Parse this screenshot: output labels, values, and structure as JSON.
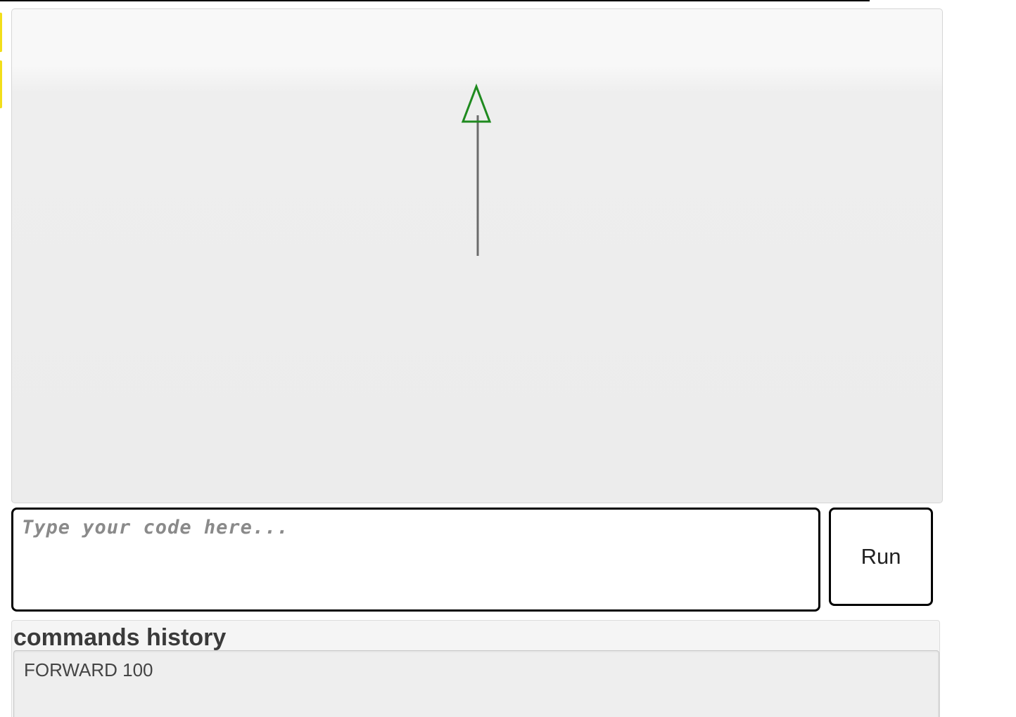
{
  "colors": {
    "turtle": "#1f8a1f",
    "path": "#6b6b6b",
    "side_tab": "#f2de1a"
  },
  "canvas": {
    "turtle_heading": "up",
    "path": [
      {
        "command": "FORWARD",
        "distance": 100
      }
    ]
  },
  "editor": {
    "placeholder": "Type your code here...",
    "value": ""
  },
  "run_button": {
    "label": "Run"
  },
  "history": {
    "title": "commands history",
    "items": [
      "FORWARD 100"
    ]
  }
}
